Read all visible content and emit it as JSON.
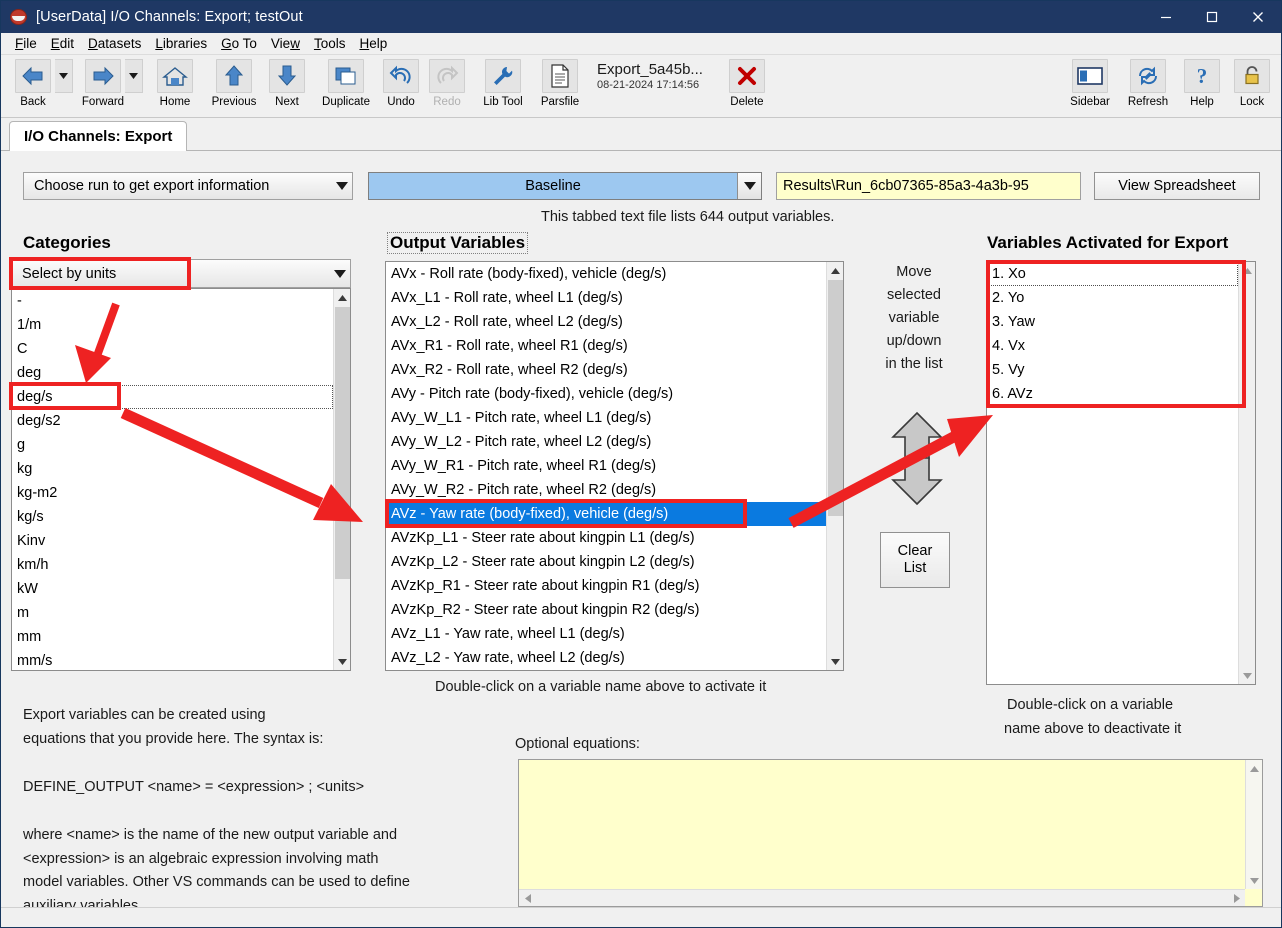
{
  "window": {
    "title": "[UserData] I/O Channels: Export; testOut",
    "app_icon": "vehiclesim-icon",
    "minimize_label": "Minimize",
    "maximize_label": "Maximize",
    "close_label": "Close"
  },
  "menubar": [
    {
      "label": "File",
      "mnemonic": "F"
    },
    {
      "label": "Edit",
      "mnemonic": "E"
    },
    {
      "label": "Datasets",
      "mnemonic": "D"
    },
    {
      "label": "Libraries",
      "mnemonic": "L"
    },
    {
      "label": "Go To",
      "mnemonic": "G"
    },
    {
      "label": "View",
      "mnemonic": "w"
    },
    {
      "label": "Tools",
      "mnemonic": "T"
    },
    {
      "label": "Help",
      "mnemonic": "H"
    }
  ],
  "toolbar": {
    "left_buttons": [
      {
        "label": "Back",
        "icon": "arrow-left-icon",
        "split": true,
        "disabled": false
      },
      {
        "label": "Forward",
        "icon": "arrow-right-icon",
        "split": true,
        "disabled": false
      },
      {
        "label": "Home",
        "icon": "home-icon",
        "split": false,
        "disabled": false
      },
      {
        "label": "Previous",
        "icon": "arrow-up-icon",
        "split": false,
        "disabled": false
      },
      {
        "label": "Next",
        "icon": "arrow-down-icon",
        "split": false,
        "disabled": false
      },
      {
        "label": "Duplicate",
        "icon": "duplicate-icon",
        "split": false,
        "disabled": false
      },
      {
        "label": "Undo",
        "icon": "undo-icon",
        "split": false,
        "disabled": false
      },
      {
        "label": "Redo",
        "icon": "redo-icon",
        "split": false,
        "disabled": true
      },
      {
        "label": "Lib Tool",
        "icon": "wrench-icon",
        "split": false,
        "disabled": false
      },
      {
        "label": "Parsfile",
        "icon": "document-icon",
        "split": false,
        "disabled": false
      }
    ],
    "file_name": "Export_5a45b...",
    "file_date": "08-21-2024 17:14:56",
    "delete": {
      "label": "Delete",
      "icon": "red-x-icon"
    },
    "right_buttons": [
      {
        "label": "Sidebar",
        "icon": "sidebar-icon"
      },
      {
        "label": "Refresh",
        "icon": "refresh-icon"
      },
      {
        "label": "Help",
        "icon": "question-mark-icon"
      },
      {
        "label": "Lock",
        "icon": "padlock-icon"
      }
    ]
  },
  "tab": {
    "label": "I/O Channels: Export"
  },
  "run_selector": {
    "choose_label": "Choose run to get export information",
    "run_name": "Baseline",
    "results_path": "Results\\Run_6cb07365-85a3-4a3b-95",
    "view_spreadsheet_label": "View Spreadsheet",
    "file_info": "This tabbed text file lists 644 output variables.",
    "output_variable_count": 644
  },
  "categories": {
    "header": "Categories",
    "selector_value": "Select by units",
    "items": [
      "-",
      "1/m",
      "C",
      "deg",
      "deg/s",
      "deg/s2",
      "g",
      "kg",
      "kg-m2",
      "kg/s",
      "Kinv",
      "km/h",
      "kW",
      "m",
      "mm",
      "mm/s"
    ],
    "focused_index": 4
  },
  "output_variables": {
    "header": "Output Variables",
    "hint": "Double-click on a variable name above to activate it",
    "items": [
      "AVx - Roll rate (body-fixed), vehicle (deg/s)",
      "AVx_L1 - Roll rate, wheel L1 (deg/s)",
      "AVx_L2 - Roll rate, wheel L2 (deg/s)",
      "AVx_R1 - Roll rate, wheel R1 (deg/s)",
      "AVx_R2 - Roll rate, wheel R2 (deg/s)",
      "AVy - Pitch rate (body-fixed), vehicle (deg/s)",
      "AVy_W_L1 - Pitch rate, wheel L1 (deg/s)",
      "AVy_W_L2 - Pitch rate, wheel L2 (deg/s)",
      "AVy_W_R1 - Pitch rate, wheel R1 (deg/s)",
      "AVy_W_R2 - Pitch rate, wheel R2 (deg/s)",
      "AVz - Yaw rate (body-fixed), vehicle (deg/s)",
      "AVzKp_L1 - Steer rate about kingpin L1 (deg/s)",
      "AVzKp_L2 - Steer rate about kingpin L2 (deg/s)",
      "AVzKp_R1 - Steer rate about kingpin R1 (deg/s)",
      "AVzKp_R2 - Steer rate about kingpin R2 (deg/s)",
      "AVz_L1 - Yaw rate, wheel L1 (deg/s)",
      "AVz_L2 - Yaw rate, wheel L2 (deg/s)"
    ],
    "selected_index": 10
  },
  "move_panel": {
    "text_lines": [
      "Move",
      "selected",
      "variable",
      "up/down",
      "in the list"
    ],
    "up_icon": "arrow-up-icon",
    "down_icon": "arrow-down-icon",
    "clear_list_label_line1": "Clear",
    "clear_list_label_line2": "List"
  },
  "activated": {
    "header": "Variables Activated for Export",
    "hint_line1": "Double-click on a variable",
    "hint_line2": "name above to deactivate it",
    "items": [
      "1. Xo",
      "2. Yo",
      "3. Yaw",
      "4. Vx",
      "5. Vy",
      "6. AVz"
    ],
    "focused_index": 0
  },
  "help_text": {
    "paragraph1": "Export variables can be created using\nequations that you provide here. The syntax is:",
    "paragraph2": "DEFINE_OUTPUT <name> = <expression> ; <units>",
    "paragraph3": "where <name> is the name of the new output variable and\n<expression> is an algebraic expression involving math\nmodel variables. Other VS commands can be used to define\nauxiliary variables."
  },
  "equations": {
    "label": "Optional equations:",
    "value": "",
    "placeholder": ""
  },
  "colors": {
    "titlebar": "#1f3864",
    "accent_blue": "#9dc8f0",
    "selection_blue": "#0a7ae0",
    "annotation_red": "#ee2222",
    "field_yellow": "#ffffcc"
  }
}
